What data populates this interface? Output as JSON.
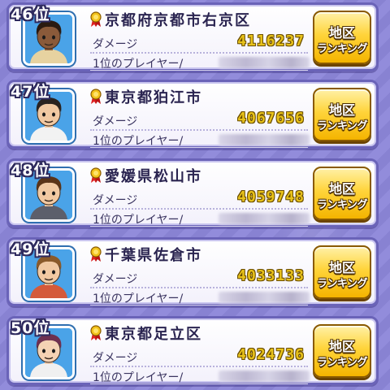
{
  "entries": [
    {
      "rank": "46位",
      "region": "京都府京都市右京区",
      "damage_label": "ダメージ",
      "damage": "4116237",
      "top_player_label": "1位のプレイヤー/",
      "button_line1": "地区",
      "button_line2": "ランキング",
      "avatar": {
        "skin": "#8a5a3a",
        "hair": "#2a1a10",
        "shirt": "#e7d2a0"
      }
    },
    {
      "rank": "47位",
      "region": "東京都狛江市",
      "damage_label": "ダメージ",
      "damage": "4067656",
      "top_player_label": "1位のプレイヤー/",
      "button_line1": "地区",
      "button_line2": "ランキング",
      "avatar": {
        "skin": "#f1c9a2",
        "hair": "#2a2320",
        "shirt": "#f2f2f2"
      }
    },
    {
      "rank": "48位",
      "region": "愛媛県松山市",
      "damage_label": "ダメージ",
      "damage": "4059748",
      "top_player_label": "1位のプレイヤー/",
      "button_line1": "地区",
      "button_line2": "ランキング",
      "avatar": {
        "skin": "#f1c9a2",
        "hair": "#5a3418",
        "shirt": "#5c5f6b"
      }
    },
    {
      "rank": "49位",
      "region": "千葉県佐倉市",
      "damage_label": "ダメージ",
      "damage": "4033133",
      "top_player_label": "1位のプレイヤー/",
      "button_line1": "地区",
      "button_line2": "ランキング",
      "avatar": {
        "skin": "#f1c9a2",
        "hair": "#8a5a2a",
        "shirt": "#d45a3a"
      }
    },
    {
      "rank": "50位",
      "region": "東京都足立区",
      "damage_label": "ダメージ",
      "damage": "4024736",
      "top_player_label": "1位のプレイヤー/",
      "button_line1": "地区",
      "button_line2": "ランキング",
      "avatar": {
        "skin": "#f4d2b4",
        "hair": "#6e3050",
        "shirt": "#f0f0f0"
      }
    }
  ]
}
